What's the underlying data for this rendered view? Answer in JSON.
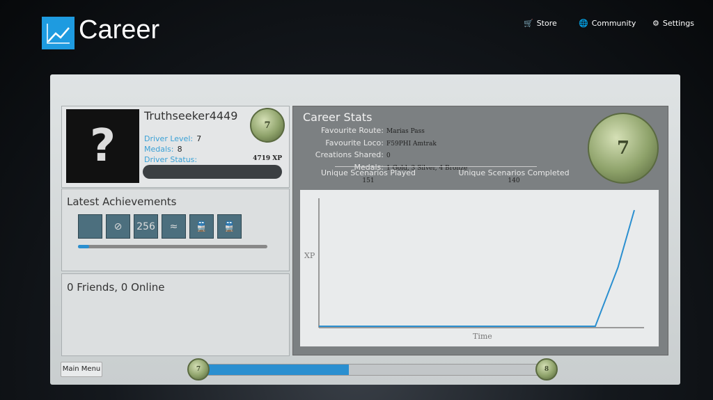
{
  "header": {
    "title": "Career",
    "logo_icon": "chart-line-icon",
    "nav": [
      {
        "label": "Store",
        "icon": "cart-icon"
      },
      {
        "label": "Community",
        "icon": "globe-icon"
      },
      {
        "label": "Settings",
        "icon": "gear-icon"
      }
    ]
  },
  "profile": {
    "username": "Truthseeker4449",
    "level_badge": "7",
    "driver_level_label": "Driver Level:",
    "driver_level": "7",
    "medals_label": "Medals:",
    "medals": "8",
    "status_label": "Driver Status:",
    "xp": "4719 XP",
    "avatar": "?"
  },
  "achievements": {
    "title": "Latest Achievements",
    "icons": [
      "xp-graph-icon",
      "no-entry-icon",
      "256-medal-icon",
      "wave-icon",
      "train-icon",
      "train-icon"
    ],
    "icon_text": [
      "",
      "⊘",
      "256",
      "≈",
      "🚆",
      "🚆"
    ],
    "progress": 0.06
  },
  "friends": {
    "title": "0 Friends, 0 Online"
  },
  "career_stats": {
    "title": "Career Stats",
    "rows": [
      {
        "label": "Favourite Route:",
        "value": "Marias Pass"
      },
      {
        "label": "Favourite Loco:",
        "value": "F59PHI Amtrak"
      },
      {
        "label": "Creations Shared:",
        "value": "0"
      },
      {
        "label": "Medals:",
        "value": "1 Gold, 3 Silver, 4 Bronze"
      }
    ],
    "played_label": "Unique Scenarios Played",
    "played": "151",
    "completed_label": "Unique Scenarios Completed",
    "completed": "140",
    "level_badge": "7"
  },
  "chart_data": {
    "type": "line",
    "xlabel": "Time",
    "ylabel": "XP",
    "color": "#2a8fd0",
    "x": [
      0,
      0.85,
      0.92,
      0.97
    ],
    "y": [
      0,
      0,
      2400,
      4719
    ],
    "ylim": [
      0,
      5200
    ],
    "xlim": [
      0,
      1
    ]
  },
  "footer": {
    "main_menu": "Main Menu",
    "level_from": "7",
    "level_to": "8",
    "progress": 0.43
  },
  "colors": {
    "accent": "#1e9be0"
  }
}
